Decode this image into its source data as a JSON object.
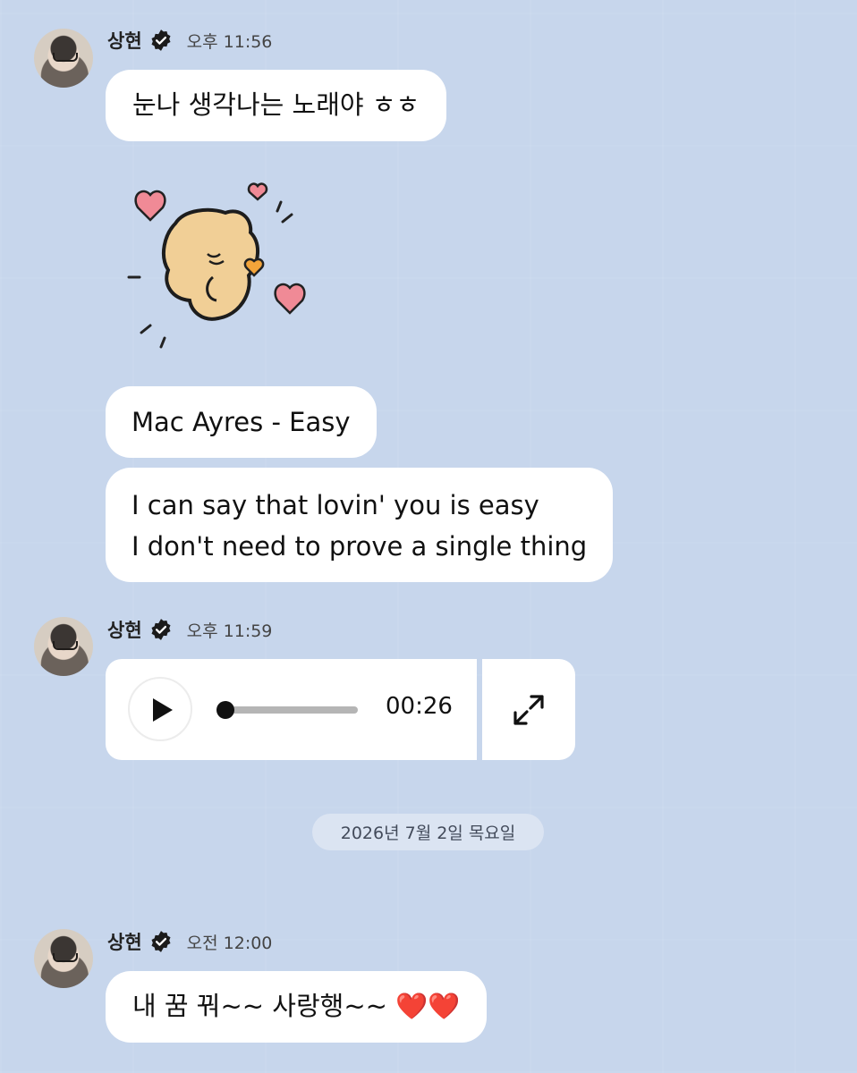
{
  "messages": [
    {
      "sender": "상현",
      "time": "오후 11:56",
      "bubbles": [
        "눈나 생각나는 노래야 ㅎㅎ",
        "Mac Ayres - Easy",
        "I can say that lovin' you is easy",
        "I don't need to prove a single thing"
      ]
    },
    {
      "sender": "상현",
      "time": "오후 11:59",
      "audio": {
        "duration": "00:26",
        "progress": 0
      }
    },
    {
      "sender": "상현",
      "time": "오전 12:00",
      "bubbles": [
        "내 꿈 꿔~~ 사랑행~~ ❤️❤️"
      ]
    }
  ],
  "date_divider": "2026년 7월 2일 목요일",
  "icons": {
    "verified": "verified-badge-icon",
    "play": "play-icon",
    "expand": "expand-icon"
  },
  "colors": {
    "background": "#c7d6ec",
    "bubble": "#ffffff",
    "heart": "#e05566"
  }
}
